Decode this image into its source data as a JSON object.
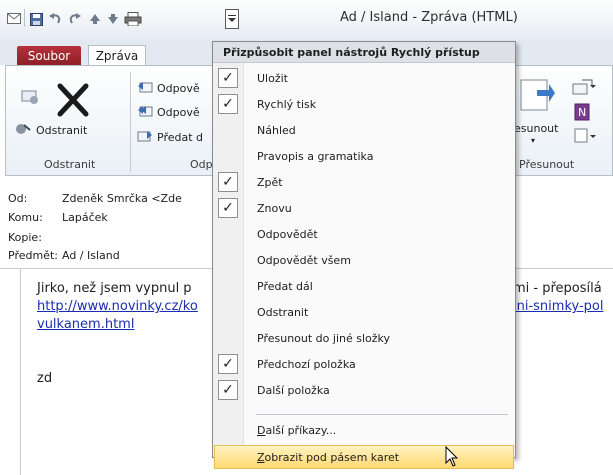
{
  "window": {
    "title": "Ad / Island - Zpráva (HTML)"
  },
  "qat": {
    "icons": [
      "mail-icon",
      "save-icon",
      "undo-icon",
      "redo-icon",
      "previous-icon",
      "next-icon",
      "print-icon"
    ]
  },
  "tabs": {
    "file": "Soubor",
    "message": "Zpráva"
  },
  "ribbon": {
    "delete_group": {
      "button": "Odstranit",
      "label": "Odstranit"
    },
    "respond_group": {
      "reply": "Odpově",
      "reply_all": "Odpově",
      "forward": "Předat d",
      "label": "Odp"
    },
    "move_group": {
      "move": "esunout",
      "label": "Přesunout"
    }
  },
  "header": {
    "from_label": "Od:",
    "from_value": "Zdeněk Smrčka <Zde",
    "to_label": "Komu:",
    "to_value": "Lapáček",
    "cc_label": "Kopie:",
    "cc_value": "",
    "subject_label": "Předmět:",
    "subject_value": "Ad / Island"
  },
  "body": {
    "line1_left": "Jirko, než jsem vypnul p",
    "line1_right": "mi - přeposílá",
    "line2_left": "http://www.novinky.cz/ko",
    "line2_right": "lni-snimky-pol",
    "line3": "vulkanem.html",
    "signature": "zd"
  },
  "menu": {
    "title": "Přizpůsobit panel nástrojů Rychlý přístup",
    "items": [
      {
        "label": "Uložit",
        "checked": true
      },
      {
        "label": "Rychlý tisk",
        "checked": true
      },
      {
        "label": "Náhled",
        "checked": false
      },
      {
        "label": "Pravopis a gramatika",
        "checked": false
      },
      {
        "label": "Zpět",
        "checked": true
      },
      {
        "label": "Znovu",
        "checked": true
      },
      {
        "label": "Odpovědět",
        "checked": false
      },
      {
        "label": "Odpovědět všem",
        "checked": false
      },
      {
        "label": "Předat dál",
        "checked": false
      },
      {
        "label": "Odstranit",
        "checked": false
      },
      {
        "label": "Přesunout do jiné složky",
        "checked": false
      },
      {
        "label": "Předchozí položka",
        "checked": true
      },
      {
        "label": "Další položka",
        "checked": true
      }
    ],
    "more_commands": {
      "accel": "D",
      "rest": "alší příkazy..."
    },
    "show_below": {
      "accel": "Z",
      "rest": "obrazit pod pásem karet"
    }
  },
  "colors": {
    "file_tab": "#a0262e",
    "highlight": "#ffe08a",
    "link": "#1a2dae"
  }
}
